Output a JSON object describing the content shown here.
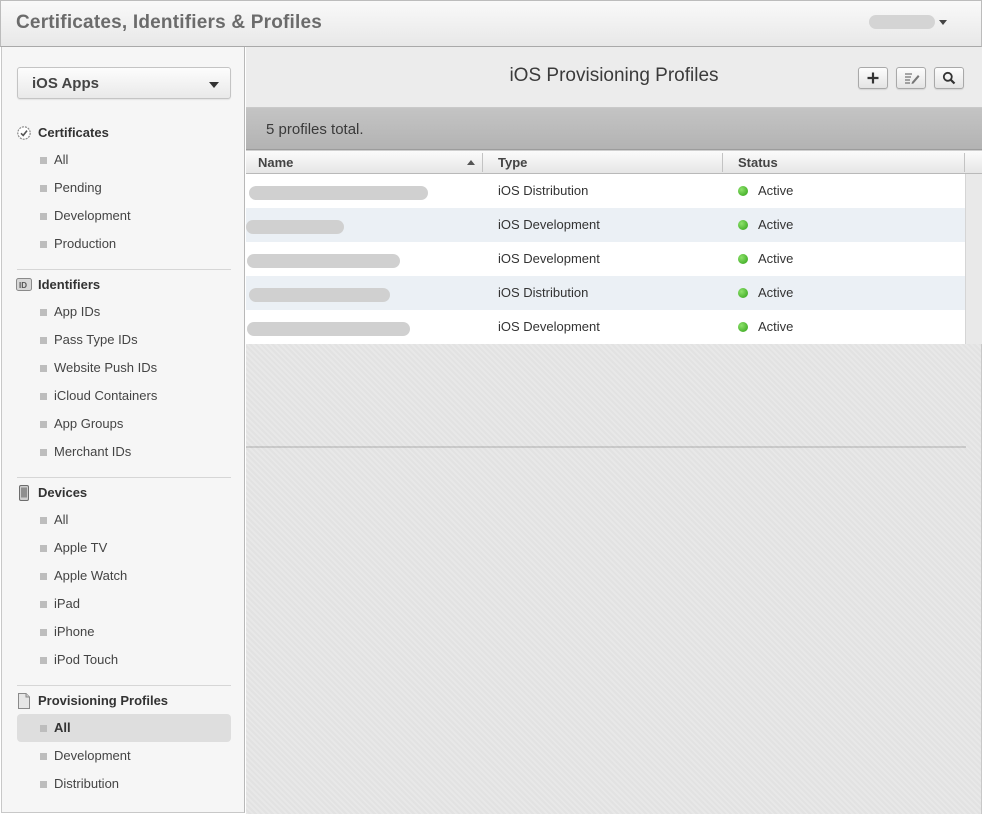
{
  "header": {
    "title": "Certificates, Identifiers & Profiles"
  },
  "sidebar": {
    "platform": "iOS Apps",
    "sections": [
      {
        "title": "Certificates",
        "icon": "certificate-icon",
        "items": [
          "All",
          "Pending",
          "Development",
          "Production"
        ]
      },
      {
        "title": "Identifiers",
        "icon": "id-icon",
        "items": [
          "App IDs",
          "Pass Type IDs",
          "Website Push IDs",
          "iCloud Containers",
          "App Groups",
          "Merchant IDs"
        ]
      },
      {
        "title": "Devices",
        "icon": "device-icon",
        "items": [
          "All",
          "Apple TV",
          "Apple Watch",
          "iPad",
          "iPhone",
          "iPod Touch"
        ]
      },
      {
        "title": "Provisioning Profiles",
        "icon": "document-icon",
        "items": [
          "All",
          "Development",
          "Distribution"
        ],
        "active_index": 0
      }
    ]
  },
  "main": {
    "title": "iOS Provisioning Profiles",
    "toolbar_icons": [
      "add-icon",
      "edit-icon",
      "search-icon"
    ],
    "summary": "5 profiles total.",
    "columns": [
      "Name",
      "Type",
      "Status"
    ],
    "rows": [
      {
        "type": "iOS Distribution",
        "status": "Active"
      },
      {
        "type": "iOS Development",
        "status": "Active"
      },
      {
        "type": "iOS Development",
        "status": "Active"
      },
      {
        "type": "iOS Distribution",
        "status": "Active"
      },
      {
        "type": "iOS Development",
        "status": "Active"
      }
    ],
    "status_color": "#3ca51c"
  }
}
